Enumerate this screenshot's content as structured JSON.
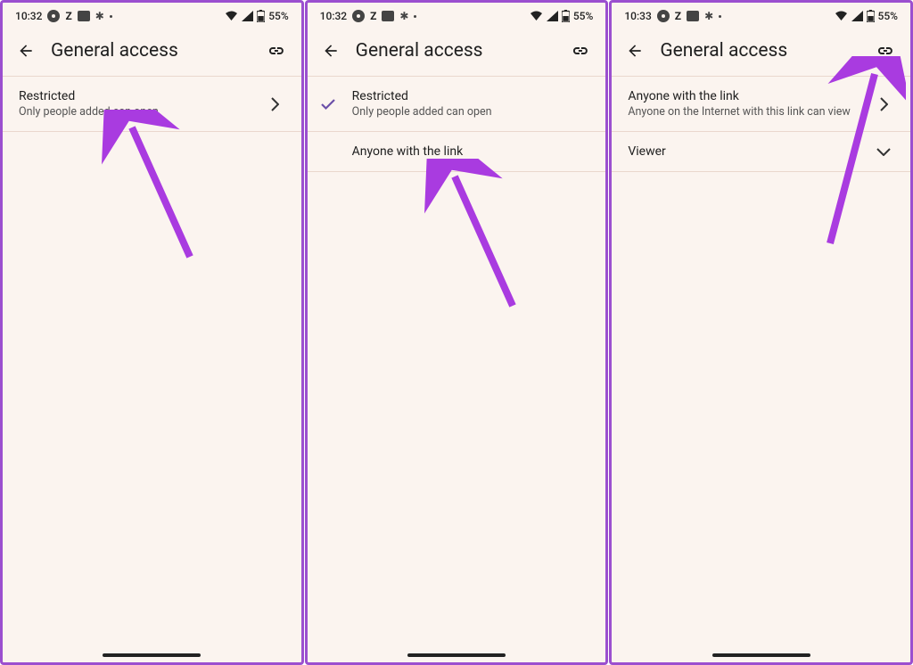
{
  "status": {
    "time": "10:32",
    "time3": "10:33",
    "z": "Z",
    "battery": "55%"
  },
  "header": {
    "title": "General access"
  },
  "panel1": {
    "row1": {
      "title": "Restricted",
      "sub": "Only people added can open"
    }
  },
  "panel2": {
    "row1": {
      "title": "Restricted",
      "sub": "Only people added can open"
    },
    "row2": {
      "title": "Anyone with the link"
    }
  },
  "panel3": {
    "row1": {
      "title": "Anyone with the link",
      "sub": "Anyone on the Internet with this link can view"
    },
    "row2": {
      "title": "Viewer"
    }
  }
}
